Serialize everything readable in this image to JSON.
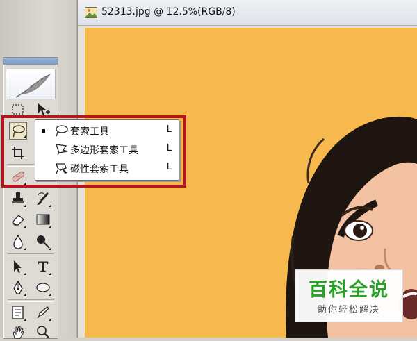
{
  "document": {
    "title": "52313.jpg @ 12.5%(RGB/8)",
    "canvas_color": "#f7b94d"
  },
  "toolbox": {
    "tools": [
      {
        "name": "rectangular-marquee-icon"
      },
      {
        "name": "move-icon"
      },
      {
        "name": "lasso-icon",
        "active": true
      },
      {
        "name": "crop-icon"
      },
      {
        "name": "healing-brush-icon"
      },
      {
        "name": "clone-stamp-icon"
      },
      {
        "name": "history-brush-icon"
      },
      {
        "name": "eraser-icon"
      },
      {
        "name": "gradient-icon"
      },
      {
        "name": "blur-icon"
      },
      {
        "name": "dodge-icon"
      },
      {
        "name": "path-selection-icon"
      },
      {
        "name": "type-icon",
        "glyph": "T"
      },
      {
        "name": "pen-icon"
      },
      {
        "name": "ellipse-icon"
      },
      {
        "name": "notes-icon"
      },
      {
        "name": "eyedropper-icon"
      },
      {
        "name": "hand-icon"
      }
    ]
  },
  "flyout": {
    "highlight_color": "#b5151b",
    "items": [
      {
        "label": "套索工具",
        "shortcut": "L",
        "checked": true,
        "icon": "lasso-icon"
      },
      {
        "label": "多边形套索工具",
        "shortcut": "L",
        "checked": false,
        "icon": "polygonal-lasso-icon"
      },
      {
        "label": "磁性套索工具",
        "shortcut": "L",
        "checked": false,
        "icon": "magnetic-lasso-icon"
      }
    ]
  },
  "watermark": {
    "brand": "百科全说",
    "slogan": "助你轻松解决",
    "brand_color": "#27a127"
  }
}
